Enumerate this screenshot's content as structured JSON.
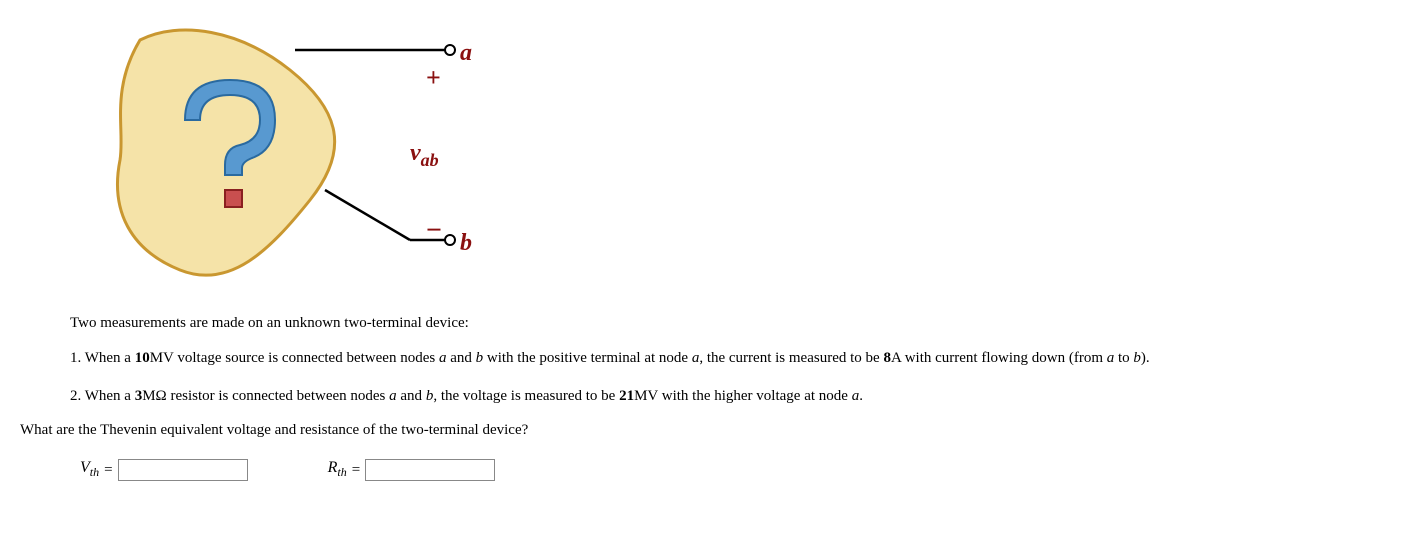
{
  "diagram": {
    "node_a_label": "a",
    "node_b_label": "b",
    "voltage_label": "v",
    "voltage_sub": "ab",
    "plus": "+",
    "minus": "−",
    "unknown_symbol": "?"
  },
  "intro": "Two measurements are made on an unknown two-terminal device:",
  "measurements": {
    "m1": {
      "num": "1. ",
      "p1": "When a ",
      "voltage_value": "10",
      "voltage_unit": "MV voltage source is connected between nodes ",
      "a": "a",
      "p2": " and ",
      "b": "b",
      "p3": " with the positive terminal at node ",
      "a2": "a",
      "p4": ", the current is measured to be ",
      "current_value": "8",
      "p5": "A with current flowing down (from ",
      "a3": "a",
      "p6": " to ",
      "b2": "b",
      "p7": ")."
    },
    "m2": {
      "num": "2. ",
      "p1": "When a ",
      "res_value": "3",
      "res_unit": "MΩ resistor is connected between nodes ",
      "a": "a",
      "p2": " and ",
      "b": "b",
      "p3": ", the voltage is measured to be ",
      "volt_value": "21",
      "p4": "MV with the higher voltage at node ",
      "a2": "a",
      "p5": "."
    }
  },
  "question": "What are the Thevenin equivalent voltage and resistance of the two-terminal device?",
  "answers": {
    "vth_label_v": "V",
    "vth_label_sub": "th",
    "eq1": " = ",
    "rth_label_r": "R",
    "rth_label_sub": "th",
    "eq2": " = "
  }
}
